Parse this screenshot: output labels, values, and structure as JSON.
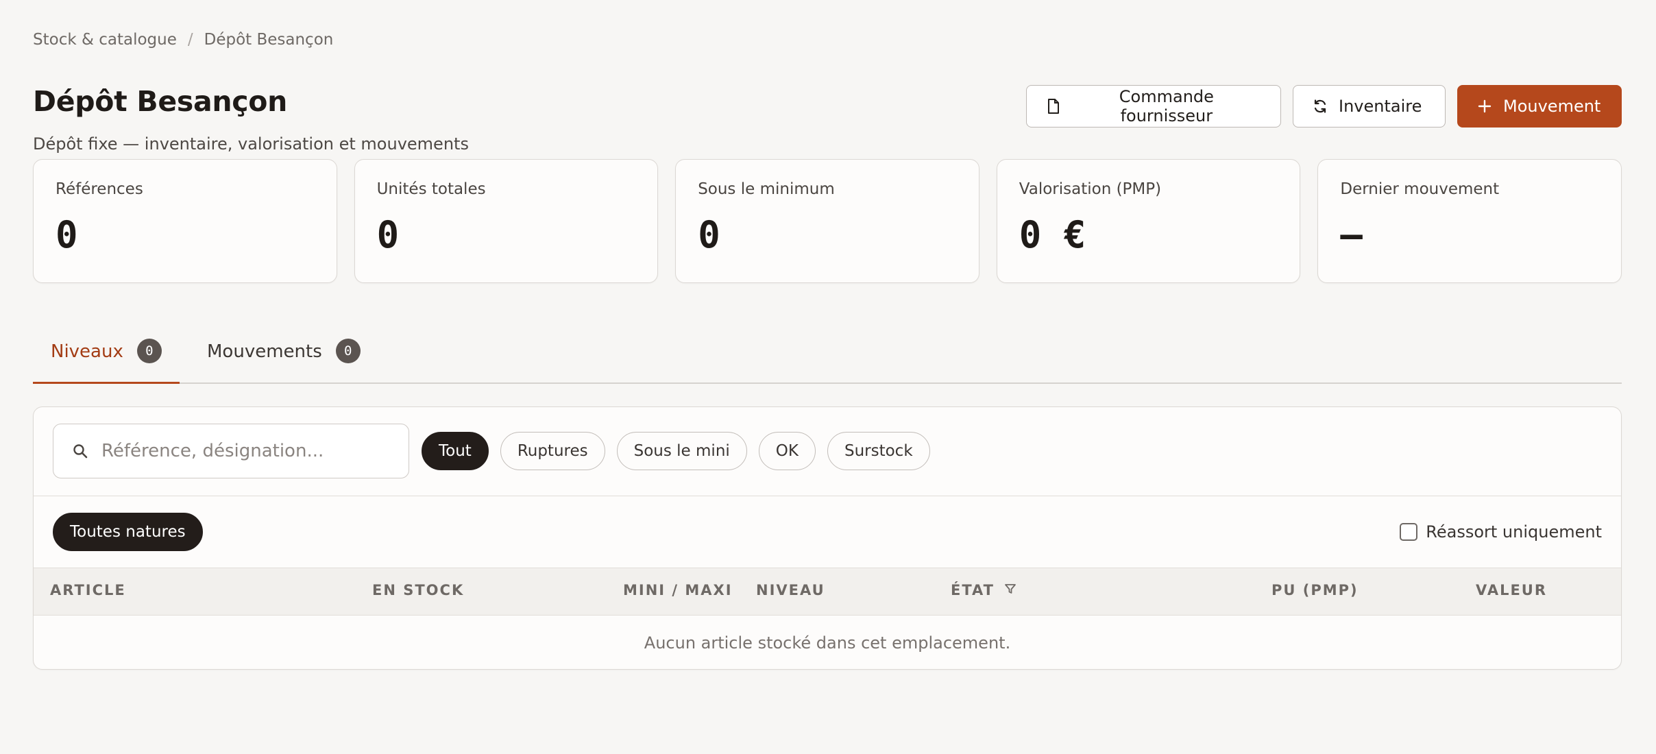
{
  "breadcrumb": {
    "parent": "Stock & catalogue",
    "separator": "/",
    "current": "Dépôt Besançon"
  },
  "header": {
    "title": "Dépôt Besançon",
    "subtitle": "Dépôt fixe — inventaire, valorisation et mouvements",
    "actions": {
      "supplier_order": "Commande fournisseur",
      "inventory": "Inventaire",
      "movement": "Mouvement"
    }
  },
  "stats": [
    {
      "label": "Références",
      "value": "0"
    },
    {
      "label": "Unités totales",
      "value": "0"
    },
    {
      "label": "Sous le minimum",
      "value": "0"
    },
    {
      "label": "Valorisation (PMP)",
      "value": "0 €"
    },
    {
      "label": "Dernier mouvement",
      "value": "—"
    }
  ],
  "tabs": [
    {
      "label": "Niveaux",
      "count": "0",
      "active": true
    },
    {
      "label": "Mouvements",
      "count": "0",
      "active": false
    }
  ],
  "filters": {
    "search_placeholder": "Référence, désignation...",
    "status_chips": [
      "Tout",
      "Ruptures",
      "Sous le mini",
      "OK",
      "Surstock"
    ],
    "active_status": "Tout",
    "nature_chip": "Toutes natures",
    "reassort_label": "Réassort uniquement"
  },
  "table": {
    "columns": [
      "ARTICLE",
      "EN STOCK",
      "MINI / MAXI",
      "NIVEAU",
      "ÉTAT",
      "PU (PMP)",
      "VALEUR"
    ],
    "empty_message": "Aucun article stocké dans cet emplacement."
  },
  "colors": {
    "accent": "#b5481c",
    "active_tab_text": "#a33c14",
    "chip_active_bg": "#231d1a",
    "background": "#f7f6f4"
  },
  "icons": {
    "supplier_order": "document-icon",
    "inventory": "refresh-icon",
    "movement": "plus-icon",
    "search": "search-icon",
    "state_filter": "filter-icon"
  }
}
